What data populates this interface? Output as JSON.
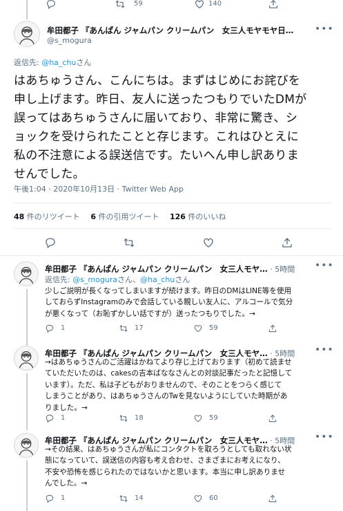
{
  "top_actions": {
    "reply": "",
    "retweet": "59",
    "like": "140",
    "share": ""
  },
  "main": {
    "author_name": "牟田都子 『あんぱん ジャムパン クリームパン　女三人モヤモヤ日…",
    "handle": "@s_mogura",
    "reply_to_prefix": "返信先: ",
    "reply_to_handle": "@ha_chu",
    "reply_to_suffix": "さん",
    "text_lines": [
      "はあちゅうさん、こんにちは。まずはじめにお詫びを",
      "申し上げます。昨日、友人に送ったつもりでいたDMが",
      "誤ってはあちゅうさんに届いており、非常に驚き、シ",
      "ョックを受けられたことと存じます。これはひとえに",
      "私の不注意による誤送信です。たいへん申し訳ありま",
      "せんでした。"
    ],
    "timestamp": "午後1:04 · 2020年10月13日 · Twitter Web App",
    "stats": {
      "retweets_num": "48",
      "retweets_label": " 件のリツイート",
      "quotes_num": "6",
      "quotes_label": " 件の引用ツイート",
      "likes_num": "126",
      "likes_label": " 件のいいね"
    }
  },
  "replies": [
    {
      "author_name": "牟田都子 『あんぱん ジャムパン クリームパン　女三人モヤ…",
      "time": " · 5時間",
      "reply_to": {
        "prefix": "返信先: ",
        "handle1": "@s_mogura",
        "mid": "さん、",
        "handle2": "@ha_chu",
        "suffix": "さん"
      },
      "lines": [
        "少しご説明が長くなってしまいますが続けます。昨日のDMはLINE等を使用",
        "しておらずInstagramのみで会話している親しい友人に、アルコールで気分",
        "が悪くなって（お恥ずかしい話ですが）送ったつもりでした。→"
      ],
      "reply_count": "1",
      "retweet_count": "17",
      "like_count": "59"
    },
    {
      "author_name": "牟田都子 『あんぱん ジャムパン クリームパン　女三人モヤ…",
      "time": " · 5時間",
      "lines": [
        "→はあちゅうさんのご活躍はかねてより存じ上げております（初めて読ませ",
        "ていただいたのは、cakesの吉本ばななさんとの対談記事だったと記憶して",
        "います）。ただ、私は子どもがおりませんので、そのことをつらく感じて",
        "しまうことがあり、はあちゅうさんのTwを見ないようにしていた時期があ",
        "りました。→"
      ],
      "reply_count": "1",
      "retweet_count": "18",
      "like_count": "59"
    },
    {
      "author_name": "牟田都子 『あんぱん ジャムパン クリームパン　女三人モヤ…",
      "time": " · 5時間",
      "lines": [
        "→その結果、はあちゅうさんが私にコンタクトを取ろうとしても取れない状",
        "態になっていて、誤送信の内容も考え合わせ、さまざまにお考えになり、",
        "不安や恐怖を感じられたのではないかと思います。本当に申し訳ありませ",
        "んでした。→"
      ],
      "reply_count": "1",
      "retweet_count": "14",
      "like_count": "60"
    }
  ],
  "icons": [
    "reply-icon",
    "retweet-icon",
    "like-icon",
    "share-icon",
    "more-icon",
    "avatar"
  ],
  "colors": {
    "link": "#1b95e0",
    "muted": "#5b7083",
    "divider": "#ebeef0",
    "text": "#0f1419"
  }
}
